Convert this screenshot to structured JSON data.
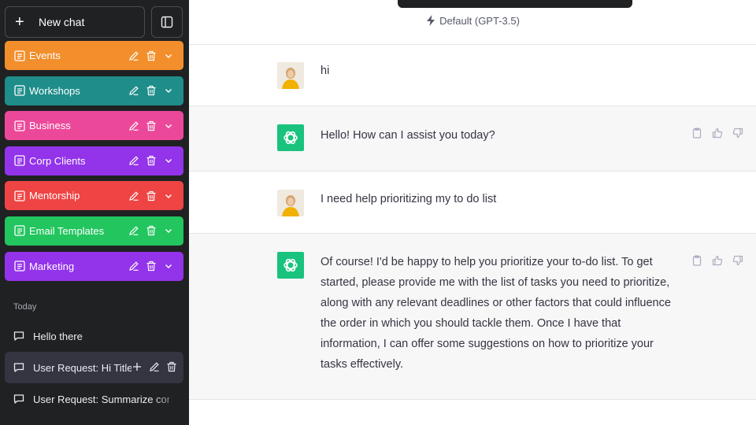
{
  "sidebar": {
    "new_chat_label": "New chat",
    "folders": [
      {
        "name": "Events",
        "color": "#f28f2c"
      },
      {
        "name": "Workshops",
        "color": "#1f8d8a"
      },
      {
        "name": "Business",
        "color": "#ec4899"
      },
      {
        "name": "Corp Clients",
        "color": "#9333ea"
      },
      {
        "name": "Mentorship",
        "color": "#ef4444"
      },
      {
        "name": "Email Templates",
        "color": "#22c55e"
      },
      {
        "name": "Marketing",
        "color": "#9333ea"
      }
    ],
    "today_label": "Today",
    "history": [
      {
        "title": "Hello there"
      },
      {
        "title": "User Request: Hi Title"
      },
      {
        "title": "User Request: Summarize con"
      }
    ]
  },
  "main": {
    "model_label": "Default (GPT-3.5)",
    "messages": [
      {
        "role": "user",
        "text": "hi"
      },
      {
        "role": "assistant",
        "text": "Hello! How can I assist you today?"
      },
      {
        "role": "user",
        "text": "I need help prioritizing my to do list"
      },
      {
        "role": "assistant",
        "text": "Of course! I'd be happy to help you prioritize your to-do list. To get started, please provide me with the list of tasks you need to prioritize, along with any relevant deadlines or other factors that could influence the order in which you should tackle them. Once I have that information, I can offer some suggestions on how to prioritize your tasks effectively."
      }
    ]
  },
  "colors": {
    "sidebar_bg": "#202123",
    "assistant_avatar": "#19c37d",
    "assistant_row_bg": "#f7f7f8"
  }
}
